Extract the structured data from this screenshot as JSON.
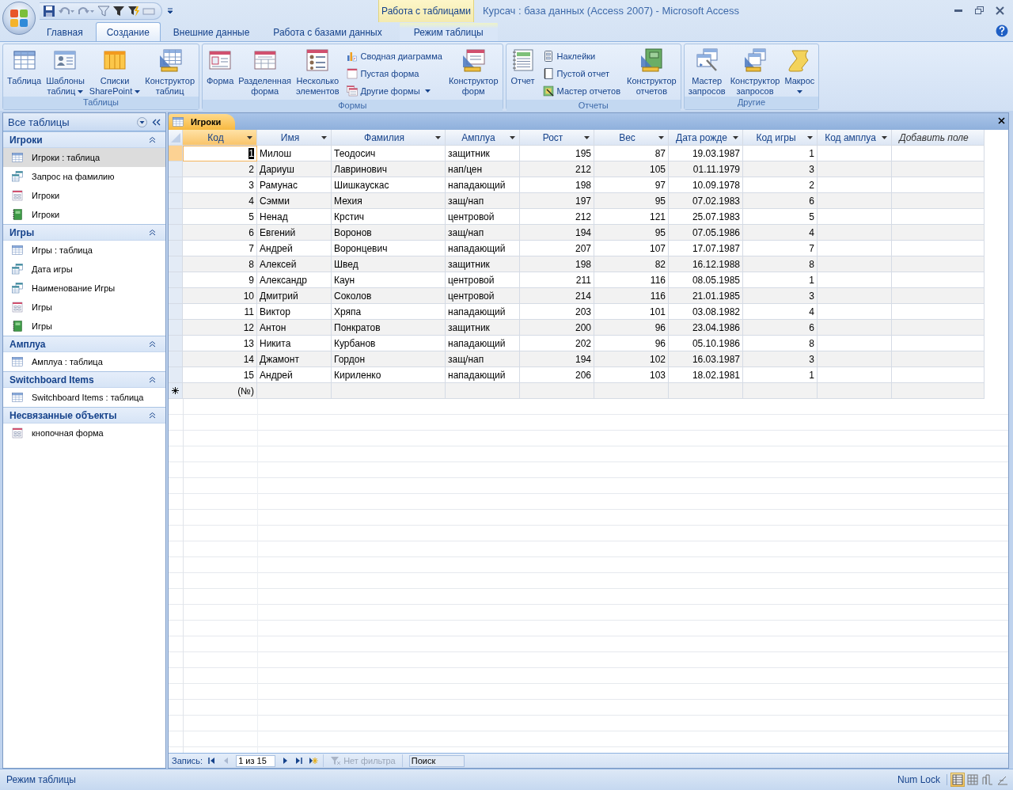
{
  "window": {
    "title": "Курсач : база данных (Access 2007) - Microsoft Access"
  },
  "context_tools": {
    "label": "Работа с таблицами"
  },
  "ribbon_tabs": [
    {
      "label": "Главная",
      "selected": false,
      "kind": "normal"
    },
    {
      "label": "Создание",
      "selected": true,
      "kind": "normal"
    },
    {
      "label": "Внешние данные",
      "selected": false,
      "kind": "normal"
    },
    {
      "label": "Работа с базами данных",
      "selected": false,
      "kind": "normal"
    },
    {
      "label": "Режим таблицы",
      "selected": false,
      "kind": "contextual"
    }
  ],
  "ribbon_groups": [
    {
      "label": "Таблицы",
      "commands": [
        {
          "kind": "large",
          "lines": [
            "Таблица"
          ]
        },
        {
          "kind": "large",
          "lines": [
            "Шаблоны",
            "таблиц"
          ],
          "dropdown": true
        },
        {
          "kind": "large",
          "lines": [
            "Списки",
            "SharePoint"
          ],
          "dropdown": true
        },
        {
          "kind": "large",
          "lines": [
            "Конструктор",
            "таблиц"
          ]
        }
      ]
    },
    {
      "label": "Формы",
      "commands": [
        {
          "kind": "large",
          "lines": [
            "Форма"
          ]
        },
        {
          "kind": "large",
          "lines": [
            "Разделенная",
            "форма"
          ]
        },
        {
          "kind": "large",
          "lines": [
            "Несколько",
            "элементов"
          ]
        },
        {
          "kind": "stack",
          "items": [
            {
              "label": "Сводная диаграмма"
            },
            {
              "label": "Пустая форма"
            },
            {
              "label": "Другие формы",
              "dropdown": true
            }
          ]
        },
        {
          "kind": "large",
          "lines": [
            "Конструктор",
            "форм"
          ]
        }
      ]
    },
    {
      "label": "Отчеты",
      "commands": [
        {
          "kind": "large",
          "lines": [
            "Отчет"
          ]
        },
        {
          "kind": "stack",
          "items": [
            {
              "label": "Наклейки"
            },
            {
              "label": "Пустой отчет"
            },
            {
              "label": "Мастер отчетов"
            }
          ]
        },
        {
          "kind": "large",
          "lines": [
            "Конструктор",
            "отчетов"
          ]
        }
      ]
    },
    {
      "label": "Другие",
      "commands": [
        {
          "kind": "large",
          "lines": [
            "Мастер",
            "запросов"
          ]
        },
        {
          "kind": "large",
          "lines": [
            "Конструктор",
            "запросов"
          ]
        },
        {
          "kind": "large",
          "lines": [
            "Макрос"
          ],
          "dropdown": true
        }
      ]
    }
  ],
  "nav_pane": {
    "header": "Все таблицы",
    "groups": [
      {
        "label": "Игроки",
        "expanded": true,
        "items": [
          {
            "label": "Игроки : таблица",
            "kind": "table",
            "selected": true
          },
          {
            "label": "Запрос на фамилию",
            "kind": "query",
            "selected": false
          },
          {
            "label": "Игроки",
            "kind": "form",
            "selected": false
          },
          {
            "label": "Игроки",
            "kind": "report",
            "selected": false
          }
        ]
      },
      {
        "label": "Игры",
        "expanded": true,
        "items": [
          {
            "label": "Игры : таблица",
            "kind": "table",
            "selected": false
          },
          {
            "label": "Дата игры",
            "kind": "query",
            "selected": false
          },
          {
            "label": "Наименование Игры",
            "kind": "query",
            "selected": false
          },
          {
            "label": "Игры",
            "kind": "form",
            "selected": false
          },
          {
            "label": "Игры",
            "kind": "report",
            "selected": false
          }
        ]
      },
      {
        "label": "Амплуа",
        "expanded": true,
        "items": [
          {
            "label": "Амплуа : таблица",
            "kind": "table",
            "selected": false
          }
        ]
      },
      {
        "label": "Switchboard Items",
        "expanded": true,
        "items": [
          {
            "label": "Switchboard Items : таблица",
            "kind": "table",
            "selected": false
          }
        ]
      },
      {
        "label": "Несвязанные объекты",
        "expanded": true,
        "items": [
          {
            "label": "кнопочная форма",
            "kind": "form",
            "selected": false
          }
        ]
      }
    ]
  },
  "document_tabs": [
    {
      "label": "Игроки",
      "selected": true
    }
  ],
  "datasheet": {
    "columns": [
      {
        "label": "Код",
        "kind": "field",
        "selected": true
      },
      {
        "label": "Имя",
        "kind": "field",
        "selected": false
      },
      {
        "label": "Фамилия",
        "kind": "field",
        "selected": false
      },
      {
        "label": "Амплуа",
        "kind": "field",
        "selected": false
      },
      {
        "label": "Рост",
        "kind": "field",
        "selected": false
      },
      {
        "label": "Вес",
        "kind": "field",
        "selected": false
      },
      {
        "label": "Дата рожде",
        "kind": "field",
        "selected": false
      },
      {
        "label": "Код игры",
        "kind": "field",
        "selected": false
      },
      {
        "label": "Код амплуа",
        "kind": "field",
        "selected": false
      },
      {
        "label": "Добавить поле",
        "kind": "add",
        "selected": false
      }
    ],
    "rows": [
      {
        "selected": true,
        "cells": [
          "1",
          "Милош",
          "Теодосич",
          "защитник",
          "195",
          "87",
          "19.03.1987",
          "1"
        ]
      },
      {
        "selected": false,
        "cells": [
          "2",
          "Дариуш",
          "Лавринович",
          "нап/цен",
          "212",
          "105",
          "01.11.1979",
          "3"
        ]
      },
      {
        "selected": false,
        "cells": [
          "3",
          "Рамунас",
          "Шишкаускас",
          "нападающий",
          "198",
          "97",
          "10.09.1978",
          "2"
        ]
      },
      {
        "selected": false,
        "cells": [
          "4",
          "Сэмми",
          "Мехия",
          "защ/нап",
          "197",
          "95",
          "07.02.1983",
          "6"
        ]
      },
      {
        "selected": false,
        "cells": [
          "5",
          "Ненад",
          "Крстич",
          "центровой",
          "212",
          "121",
          "25.07.1983",
          "5"
        ]
      },
      {
        "selected": false,
        "cells": [
          "6",
          "Евгений",
          "Воронов",
          "защ/нап",
          "194",
          "95",
          "07.05.1986",
          "4"
        ]
      },
      {
        "selected": false,
        "cells": [
          "7",
          "Андрей",
          "Воронцевич",
          "нападающий",
          "207",
          "107",
          "17.07.1987",
          "7"
        ]
      },
      {
        "selected": false,
        "cells": [
          "8",
          "Алексей",
          "Швед",
          "защитник",
          "198",
          "82",
          "16.12.1988",
          "8"
        ]
      },
      {
        "selected": false,
        "cells": [
          "9",
          "Александр",
          "Каун",
          "центровой",
          "211",
          "116",
          "08.05.1985",
          "1"
        ]
      },
      {
        "selected": false,
        "cells": [
          "10",
          "Дмитрий",
          "Соколов",
          "центровой",
          "214",
          "116",
          "21.01.1985",
          "3"
        ]
      },
      {
        "selected": false,
        "cells": [
          "11",
          "Виктор",
          "Хряпа",
          "нападающий",
          "203",
          "101",
          "03.08.1982",
          "4"
        ]
      },
      {
        "selected": false,
        "cells": [
          "12",
          "Антон",
          "Понкратов",
          "защитник",
          "200",
          "96",
          "23.04.1986",
          "6"
        ]
      },
      {
        "selected": false,
        "cells": [
          "13",
          "Никита",
          "Курбанов",
          "нападающий",
          "202",
          "96",
          "05.10.1986",
          "8"
        ]
      },
      {
        "selected": false,
        "cells": [
          "14",
          "Джамонт",
          "Гордон",
          "защ/нап",
          "194",
          "102",
          "16.03.1987",
          "3"
        ]
      },
      {
        "selected": false,
        "cells": [
          "15",
          "Андрей",
          "Кириленко",
          "нападающий",
          "206",
          "103",
          "18.02.1981",
          "1"
        ]
      }
    ],
    "new_row": {
      "cells": [
        "(№)"
      ]
    }
  },
  "record_nav": {
    "label": "Запись:",
    "position": "1 из 15",
    "filter": {
      "label": "Нет фильтра",
      "disabled": true
    },
    "search": {
      "placeholder": "Поиск"
    }
  },
  "status_bar": {
    "text": "Режим таблицы",
    "indicator": "Num Lock",
    "views": [
      {
        "selected": true
      },
      {
        "selected": false
      },
      {
        "selected": false
      },
      {
        "selected": false
      }
    ]
  }
}
